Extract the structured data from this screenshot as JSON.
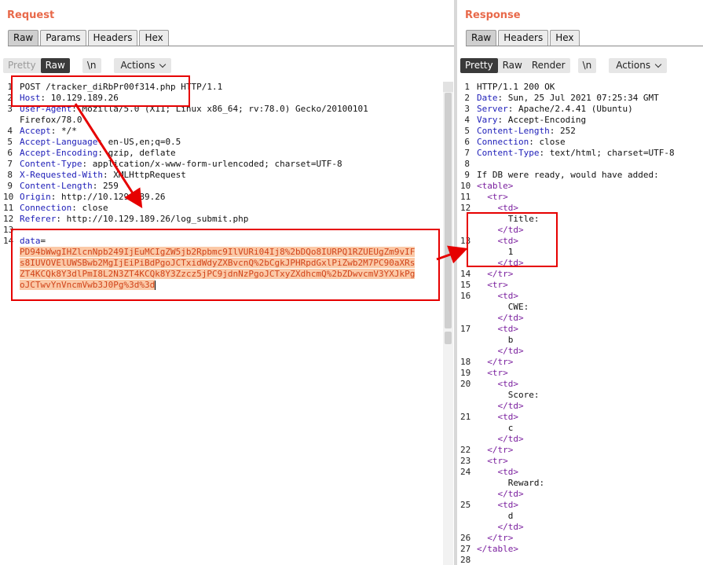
{
  "request": {
    "title": "Request",
    "tabs": [
      "Raw",
      "Params",
      "Headers",
      "Hex"
    ],
    "toolbar": {
      "pretty": "Pretty",
      "raw": "Raw",
      "newline": "\\n",
      "actions": "Actions"
    },
    "lines": [
      {
        "num": "1",
        "value": "POST /tracker_diRbPr00f314.php HTTP/1.1"
      },
      {
        "num": "2",
        "key": "Host",
        "value": " 10.129.189.26"
      },
      {
        "num": "3",
        "key": "User-Agent",
        "value": " Mozilla/5.0 (X11; Linux x86_64; rv:78.0) Gecko/20100101"
      },
      {
        "num": "",
        "value": "Firefox/78.0"
      },
      {
        "num": "4",
        "key": "Accept",
        "value": " */*"
      },
      {
        "num": "5",
        "key": "Accept-Language",
        "value": " en-US,en;q=0.5"
      },
      {
        "num": "6",
        "key": "Accept-Encoding",
        "value": " gzip, deflate"
      },
      {
        "num": "7",
        "key": "Content-Type",
        "value": " application/x-www-form-urlencoded; charset=UTF-8"
      },
      {
        "num": "8",
        "key": "X-Requested-With",
        "value": " XMLHttpRequest"
      },
      {
        "num": "9",
        "key": "Content-Length",
        "value": " 259"
      },
      {
        "num": "10",
        "key": "Origin",
        "value": " http://10.129.189.26"
      },
      {
        "num": "11",
        "key": "Connection",
        "value": " close"
      },
      {
        "num": "12",
        "key": "Referer",
        "value": " http://10.129.189.26/log_submit.php"
      },
      {
        "num": "13",
        "value": ""
      },
      {
        "num": "14",
        "key": "data",
        "value": "="
      },
      {
        "num": "",
        "value": "PD94bWwgIHZlcnNpb249IjEuMCIgZW5jb2Rpbmc9IlVURi04Ij8%2bDQo8IURPQ1RZUEUgZm9vIF",
        "encoded": true
      },
      {
        "num": "",
        "value": "s8IUVOVElUWSBwb2MgIjEiPiBdPgoJCTxidWdyZXBvcnQ%2bCgkJPHRpdGxlPiZwb2M7PC90aXRs",
        "encoded": true
      },
      {
        "num": "",
        "value": "ZT4KCQk8Y3dlPmI8L2N3ZT4KCQk8Y3Zzcz5jPC9jdnNzPgoJCTxyZXdhcmQ%2bZDwvcmV3YXJkPg",
        "encoded": true
      },
      {
        "num": "",
        "value": "oJCTwvYnVncmVwb3J0Pg%3d%3d",
        "encoded": true,
        "caret": true
      }
    ]
  },
  "response": {
    "title": "Response",
    "tabs": [
      "Raw",
      "Headers",
      "Hex"
    ],
    "toolbar": {
      "pretty": "Pretty",
      "raw": "Raw",
      "render": "Render",
      "newline": "\\n",
      "actions": "Actions"
    },
    "lines": [
      {
        "num": "1",
        "value": "HTTP/1.1 200 OK"
      },
      {
        "num": "2",
        "key": "Date",
        "value": " Sun, 25 Jul 2021 07:25:34 GMT"
      },
      {
        "num": "3",
        "key": "Server",
        "value": " Apache/2.4.41 (Ubuntu)"
      },
      {
        "num": "4",
        "key": "Vary",
        "value": " Accept-Encoding"
      },
      {
        "num": "5",
        "key": "Content-Length",
        "value": " 252"
      },
      {
        "num": "6",
        "key": "Connection",
        "value": " close"
      },
      {
        "num": "7",
        "key": "Content-Type",
        "value": " text/html; charset=UTF-8"
      },
      {
        "num": "8",
        "value": ""
      },
      {
        "num": "9",
        "value": "If DB were ready, would have added:"
      },
      {
        "num": "10",
        "tag": "<table>"
      },
      {
        "num": "11",
        "indent": "  ",
        "tag": "<tr>"
      },
      {
        "num": "12",
        "indent": "    ",
        "tag": "<td>"
      },
      {
        "num": "",
        "indent": "      ",
        "value": "Title:"
      },
      {
        "num": "",
        "indent": "    ",
        "tag": "</td>"
      },
      {
        "num": "13",
        "indent": "    ",
        "tag": "<td>"
      },
      {
        "num": "",
        "indent": "      ",
        "value": "1"
      },
      {
        "num": "",
        "indent": "    ",
        "tag": "</td>"
      },
      {
        "num": "14",
        "indent": "  ",
        "tag": "</tr>"
      },
      {
        "num": "15",
        "indent": "  ",
        "tag": "<tr>"
      },
      {
        "num": "16",
        "indent": "    ",
        "tag": "<td>"
      },
      {
        "num": "",
        "indent": "      ",
        "value": "CWE:"
      },
      {
        "num": "",
        "indent": "    ",
        "tag": "</td>"
      },
      {
        "num": "17",
        "indent": "    ",
        "tag": "<td>"
      },
      {
        "num": "",
        "indent": "      ",
        "value": "b"
      },
      {
        "num": "",
        "indent": "    ",
        "tag": "</td>"
      },
      {
        "num": "18",
        "indent": "  ",
        "tag": "</tr>"
      },
      {
        "num": "19",
        "indent": "  ",
        "tag": "<tr>"
      },
      {
        "num": "20",
        "indent": "    ",
        "tag": "<td>"
      },
      {
        "num": "",
        "indent": "      ",
        "value": "Score:"
      },
      {
        "num": "",
        "indent": "    ",
        "tag": "</td>"
      },
      {
        "num": "21",
        "indent": "    ",
        "tag": "<td>"
      },
      {
        "num": "",
        "indent": "      ",
        "value": "c"
      },
      {
        "num": "",
        "indent": "    ",
        "tag": "</td>"
      },
      {
        "num": "22",
        "indent": "  ",
        "tag": "</tr>"
      },
      {
        "num": "23",
        "indent": "  ",
        "tag": "<tr>"
      },
      {
        "num": "24",
        "indent": "    ",
        "tag": "<td>"
      },
      {
        "num": "",
        "indent": "      ",
        "value": "Reward:"
      },
      {
        "num": "",
        "indent": "    ",
        "tag": "</td>"
      },
      {
        "num": "25",
        "indent": "    ",
        "tag": "<td>"
      },
      {
        "num": "",
        "indent": "      ",
        "value": "d"
      },
      {
        "num": "",
        "indent": "    ",
        "tag": "</td>"
      },
      {
        "num": "26",
        "indent": "  ",
        "tag": "</tr>"
      },
      {
        "num": "27",
        "tag": "</table>"
      },
      {
        "num": "28",
        "value": ""
      }
    ]
  },
  "colors": {
    "title": "#e8694a",
    "header_key": "#1d1db8",
    "tag": "#7a1f9e",
    "encoded": "#d1441a",
    "annotation": "#e60000"
  }
}
